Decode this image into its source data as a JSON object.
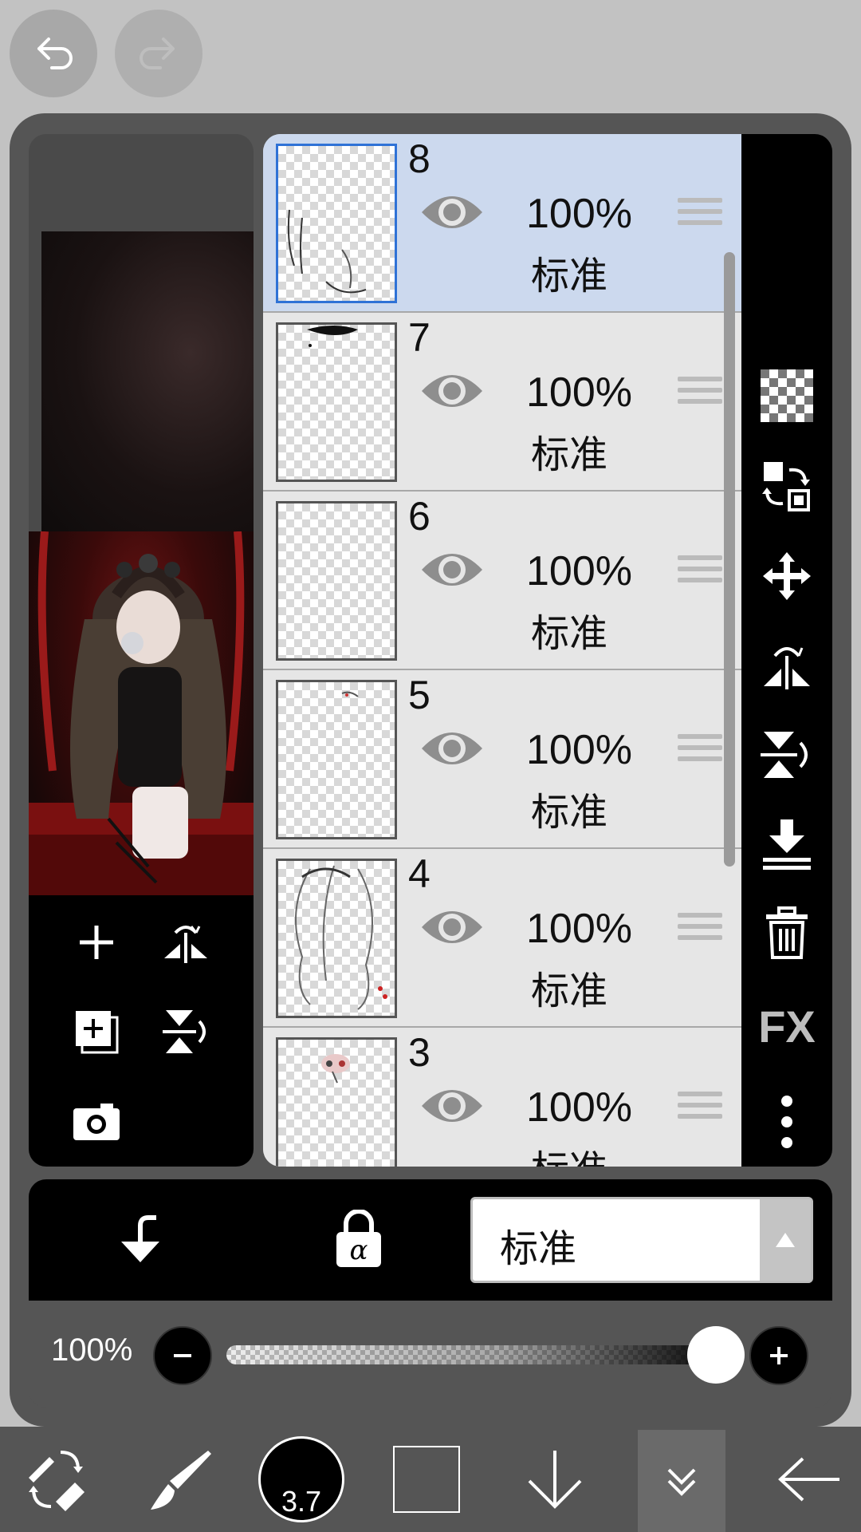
{
  "top": {
    "undo_icon": "undo-icon",
    "redo_icon": "redo-icon"
  },
  "layers": [
    {
      "number": "8",
      "opacity": "100%",
      "blend_mode": "标准",
      "selected": true
    },
    {
      "number": "7",
      "opacity": "100%",
      "blend_mode": "标准",
      "selected": false
    },
    {
      "number": "6",
      "opacity": "100%",
      "blend_mode": "标准",
      "selected": false
    },
    {
      "number": "5",
      "opacity": "100%",
      "blend_mode": "标准",
      "selected": false
    },
    {
      "number": "4",
      "opacity": "100%",
      "blend_mode": "标准",
      "selected": false
    },
    {
      "number": "3",
      "opacity": "100%",
      "blend_mode": "标准",
      "selected": false
    }
  ],
  "right_bar": {
    "fx_label": "FX",
    "icons": [
      "transparency-icon",
      "swap-layer-icon",
      "move-icon",
      "flip-horizontal-icon",
      "flip-vertical-icon",
      "merge-down-icon",
      "trash-icon",
      "fx-icon",
      "more-icon"
    ]
  },
  "bottom_panel": {
    "blend_mode_value": "标准"
  },
  "opacity": {
    "label": "100%",
    "value_fraction": 1.0
  },
  "toolbar": {
    "brush_size": "3.7",
    "icons": [
      "tool-switch-icon",
      "brush-icon",
      "color-icon",
      "layer-swatch-icon",
      "arrow-down-icon",
      "double-chevron-down-icon",
      "back-arrow-icon"
    ]
  },
  "colors": {
    "accent": "#2f72d6",
    "selected_row": "#ccd9ee",
    "panel": "#555555",
    "background": "#c2c2c2"
  }
}
